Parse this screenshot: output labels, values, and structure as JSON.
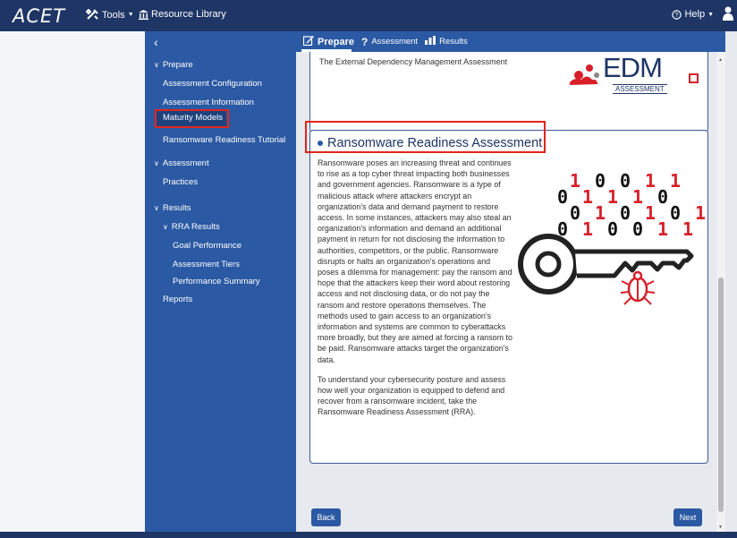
{
  "app": {
    "logo": "ACET"
  },
  "topbar": {
    "tools_label": "Tools",
    "library_label": "Resource Library",
    "help_label": "Help"
  },
  "sidebar": {
    "back_glyph": "‹",
    "prepare": "Prepare",
    "assessment_configuration": "Assessment Configuration",
    "assessment_information": "Assessment Information",
    "maturity_models": "Maturity Models",
    "ransomware_tutorial": "Ransomware Readiness Tutorial",
    "assessment": "Assessment",
    "practices": "Practices",
    "results": "Results",
    "rra_results": "RRA Results",
    "goal_performance": "Goal Performance",
    "assessment_tiers": "Assessment Tiers",
    "performance_summary": "Performance Summary",
    "reports": "Reports"
  },
  "tabs": {
    "prepare": "Prepare",
    "assessment": "Assessment",
    "results": "Results"
  },
  "edm_card": {
    "text": "The External Dependency Management Assessment",
    "logo_main": "EDM",
    "logo_sub": "ASSESSMENT"
  },
  "rra_card": {
    "title": "Ransomware Readiness Assessment",
    "para1": "Ransomware poses an increasing threat and continues to rise as a top cyber threat impacting both businesses and government agencies. Ransomware is a type of malicious attack where attackers encrypt an organization's data and demand payment to restore access. In some instances, attackers may also steal an organization's information and demand an additional payment in return for not disclosing the information to authorities, competitors, or the public. Ransomware disrupts or halts an organization's operations and poses a dilemma for management: pay the ransom and hope that the attackers keep their word about restoring access and not disclosing data, or do not pay the ransom and restore operations themselves. The methods used to gain access to an organization's information and systems are common to cyberattacks more broadly, but they are aimed at forcing a ransom to be paid. Ransomware attacks target the organization's data.",
    "para2": "To understand your cybersecurity posture and assess how well your organization is equipped to defend and recover from a ransomware incident, take the Ransomware Readiness Assessment (RRA).",
    "binary_rows": [
      [
        "1",
        "0",
        "0",
        "1",
        "1"
      ],
      [
        "0",
        "1",
        "1",
        "1",
        "0"
      ],
      [
        "0",
        "1",
        "0",
        "1",
        "0",
        "1"
      ],
      [
        "0",
        "1",
        "0",
        "0",
        "1",
        "1"
      ]
    ]
  },
  "buttons": {
    "back": "Back",
    "next": "Next"
  },
  "colors": {
    "topbar": "#1e3566",
    "sidebar": "#2b59a3",
    "highlight": "#e3241b",
    "binary_red": "#d8202a"
  }
}
